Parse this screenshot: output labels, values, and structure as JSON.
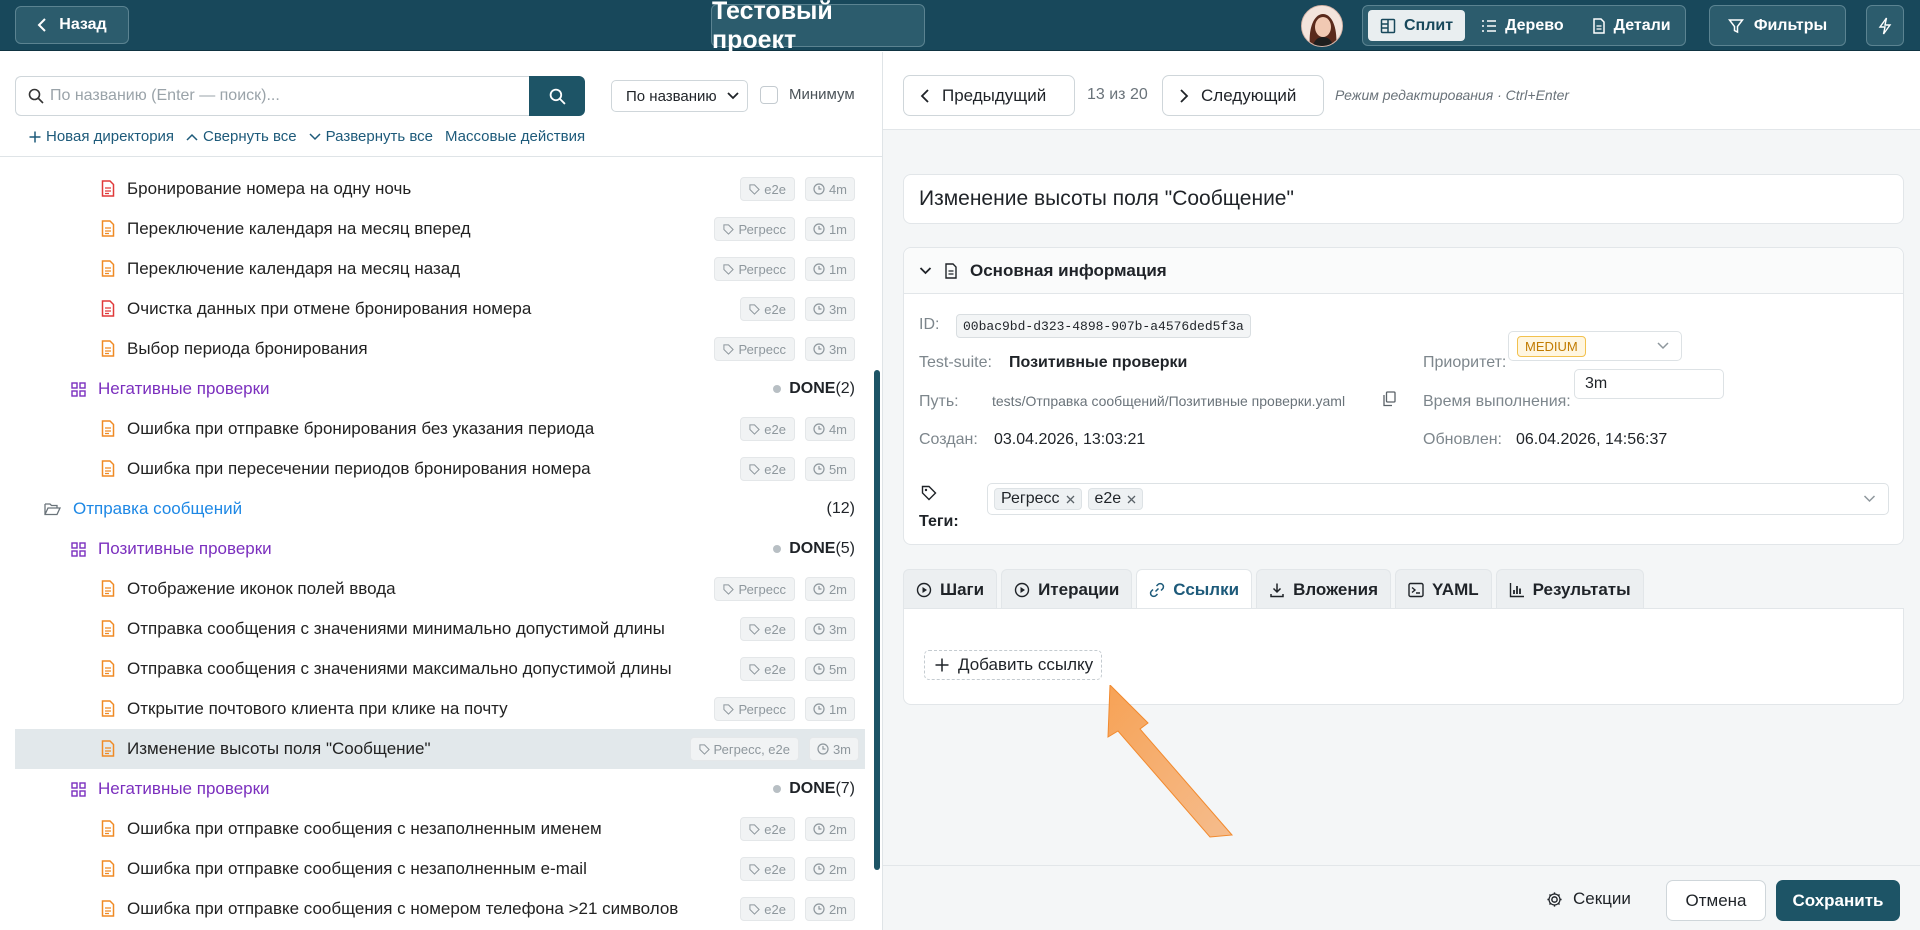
{
  "header": {
    "back_label": "Назад",
    "project_title": "Тестовый проект",
    "views": [
      {
        "label": "Сплит",
        "icon": "split-view-icon",
        "active": true
      },
      {
        "label": "Дерево",
        "icon": "list-icon",
        "active": false
      },
      {
        "label": "Детали",
        "icon": "document-icon",
        "active": false
      }
    ],
    "filters_label": "Фильтры"
  },
  "left": {
    "search_placeholder": "По названию (Enter — поиск)...",
    "sort_value": "По названию",
    "minimum_label": "Минимум",
    "actions": [
      {
        "label": "Новая директория",
        "icon": "plus-icon"
      },
      {
        "label": "Свернуть все",
        "icon": "chevron-up-icon"
      },
      {
        "label": "Развернуть все",
        "icon": "chevron-down-icon"
      },
      {
        "label": "Массовые действия",
        "icon": ""
      }
    ],
    "tree": [
      {
        "kind": "case",
        "label": "Бронирование номера на одну ночь",
        "tag": "e2e",
        "time": "4m",
        "icon_color": "#e03a3a"
      },
      {
        "kind": "case",
        "label": "Переключение календаря на месяц вперед",
        "tag": "Регресс",
        "time": "1m",
        "icon_color": "#f08a24"
      },
      {
        "kind": "case",
        "label": "Переключение календаря на месяц назад",
        "tag": "Регресс",
        "time": "1m",
        "icon_color": "#f08a24"
      },
      {
        "kind": "case",
        "label": "Очистка данных при отмене бронирования номера",
        "tag": "e2e",
        "time": "3m",
        "icon_color": "#e03a3a"
      },
      {
        "kind": "case",
        "label": "Выбор периода бронирования",
        "tag": "Регресс",
        "time": "3m",
        "icon_color": "#f08a24"
      },
      {
        "kind": "group",
        "label": "Негативные проверки",
        "status": "DONE",
        "count": "(2)"
      },
      {
        "kind": "case",
        "label": "Ошибка при отправке бронирования без указания периода",
        "tag": "e2e",
        "time": "4m",
        "icon_color": "#f08a24"
      },
      {
        "kind": "case",
        "label": "Ошибка при пересечении периодов бронирования номера",
        "tag": "e2e",
        "time": "5m",
        "icon_color": "#f08a24"
      },
      {
        "kind": "folder",
        "label": "Отправка сообщений",
        "count": "(12)"
      },
      {
        "kind": "group",
        "label": "Позитивные проверки",
        "status": "DONE",
        "count": "(5)"
      },
      {
        "kind": "case",
        "label": "Отображение иконок полей ввода",
        "tag": "Регресс",
        "time": "2m",
        "icon_color": "#f08a24"
      },
      {
        "kind": "case",
        "label": "Отправка сообщения с значениями минимально допустимой длины",
        "tag": "e2e",
        "time": "3m",
        "icon_color": "#f08a24"
      },
      {
        "kind": "case",
        "label": "Отправка сообщения с значениями максимально допустимой длины",
        "tag": "e2e",
        "time": "5m",
        "icon_color": "#f08a24"
      },
      {
        "kind": "case",
        "label": "Открытие почтового клиента при клике на почту",
        "tag": "Регресс",
        "time": "1m",
        "icon_color": "#f08a24"
      },
      {
        "kind": "case",
        "label": "Изменение высоты поля \"Сообщение\"",
        "tag": "Регресс, e2e",
        "time": "3m",
        "icon_color": "#f08a24",
        "selected": true
      },
      {
        "kind": "group",
        "label": "Негативные проверки",
        "status": "DONE",
        "count": "(7)"
      },
      {
        "kind": "case",
        "label": "Ошибка при отправке сообщения с незаполненным именем",
        "tag": "e2e",
        "time": "2m",
        "icon_color": "#f08a24"
      },
      {
        "kind": "case",
        "label": "Ошибка при отправке сообщения с незаполненным e-mail",
        "tag": "e2e",
        "time": "2m",
        "icon_color": "#f08a24"
      },
      {
        "kind": "case",
        "label": "Ошибка при отправке сообщения с номером телефона >21 символов",
        "tag": "e2e",
        "time": "2m",
        "icon_color": "#f08a24"
      }
    ]
  },
  "right": {
    "prev_label": "Предыдущий",
    "counter": "13 из 20",
    "next_label": "Следующий",
    "edit_mode": "Режим редактирования · Ctrl+Enter",
    "title": "Изменение высоты поля \"Сообщение\"",
    "info": {
      "heading": "Основная информация",
      "id_label": "ID:",
      "id_value": "00bac9bd-d323-4898-907b-a4576ded5f3a",
      "suite_label": "Test-suite:",
      "suite_value": "Позитивные проверки",
      "path_label": "Путь:",
      "path_value": "tests/Отправка сообщений/Позитивные проверки.yaml",
      "created_label": "Создан:",
      "created_value": "03.04.2026, 13:03:21",
      "priority_label": "Приоритет:",
      "priority_value": "MEDIUM",
      "duration_label": "Время выполнения:",
      "duration_value": "3m",
      "updated_label": "Обновлен:",
      "updated_value": "06.04.2026, 14:56:37",
      "tags_label": "Теги:",
      "tags": [
        "Регресс",
        "e2e"
      ]
    },
    "tabs": [
      {
        "label": "Шаги",
        "icon": "play-circle-icon",
        "active": false
      },
      {
        "label": "Итерации",
        "icon": "play-circle-icon",
        "active": false
      },
      {
        "label": "Ссылки",
        "icon": "link-icon",
        "active": true
      },
      {
        "label": "Вложения",
        "icon": "download-icon",
        "active": false
      },
      {
        "label": "YAML",
        "icon": "terminal-icon",
        "active": false
      },
      {
        "label": "Результаты",
        "icon": "bar-chart-icon",
        "active": false
      }
    ],
    "add_link_label": "Добавить ссылку",
    "footer": {
      "sections_label": "Секции",
      "cancel_label": "Отмена",
      "save_label": "Сохранить"
    }
  }
}
